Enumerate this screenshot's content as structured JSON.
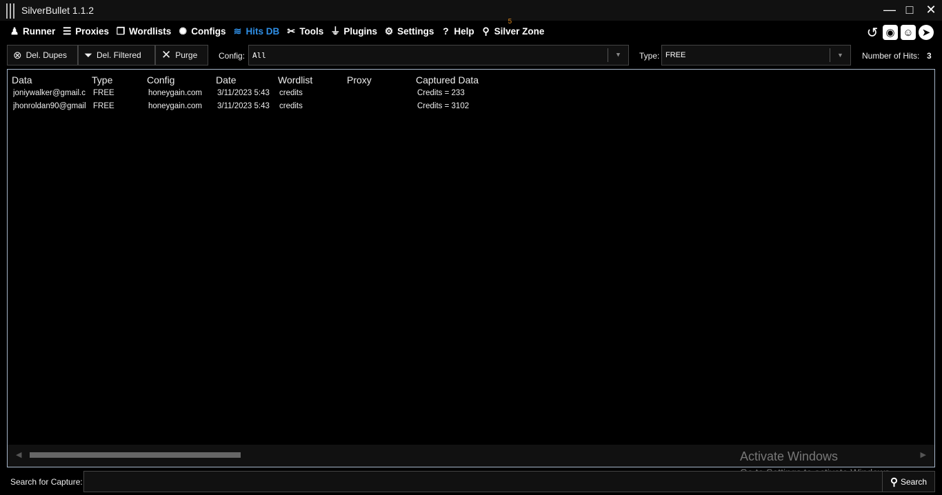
{
  "app": {
    "title": "SilverBullet 1.1.2"
  },
  "window": {
    "minimize": "—",
    "maximize": "□",
    "close": "✕"
  },
  "nav": [
    {
      "label": "Runner",
      "icon": "runner-icon",
      "glyph": "♟"
    },
    {
      "label": "Proxies",
      "icon": "server-icon",
      "glyph": "☰"
    },
    {
      "label": "Wordlists",
      "icon": "files-icon",
      "glyph": "❐"
    },
    {
      "label": "Configs",
      "icon": "gear-wheel-icon",
      "glyph": "✺"
    },
    {
      "label": "Hits DB",
      "icon": "database-icon",
      "glyph": "≋"
    },
    {
      "label": "Tools",
      "icon": "tools-icon",
      "glyph": "✂"
    },
    {
      "label": "Plugins",
      "icon": "plug-icon",
      "glyph": "⏚"
    },
    {
      "label": "Settings",
      "icon": "settings-icon",
      "glyph": "⚙"
    },
    {
      "label": "Help",
      "icon": "help-icon",
      "glyph": "?"
    },
    {
      "label": "Silver Zone",
      "icon": "location-icon",
      "glyph": "⚲",
      "badge": "5"
    }
  ],
  "toolbar": {
    "dupes": "Del. Dupes",
    "filtered": "Del. Filtered",
    "purge": "Purge",
    "config_label": "Config:",
    "config_value": "All",
    "type_label": "Type:",
    "type_value": "FREE",
    "hits_label": "Number of Hits:",
    "hits_value": "3"
  },
  "table": {
    "columns": [
      "Data",
      "Type",
      "Config",
      "Date",
      "Wordlist",
      "Proxy",
      "Captured Data"
    ],
    "rows": [
      [
        "joniywalker@gmail.c",
        "FREE",
        "honeygain.com",
        "3/11/2023 5:43",
        "credits",
        "",
        "Credits = 233"
      ],
      [
        "jhonroldan90@gmail",
        "FREE",
        "honeygain.com",
        "3/11/2023 5:43",
        "credits",
        "",
        "Credits = 3102"
      ]
    ]
  },
  "watermark": {
    "title": "Activate Windows",
    "sub": "Go to Settings to activate Windows."
  },
  "search": {
    "label": "Search for Capture:",
    "value": "",
    "button": "Search"
  }
}
